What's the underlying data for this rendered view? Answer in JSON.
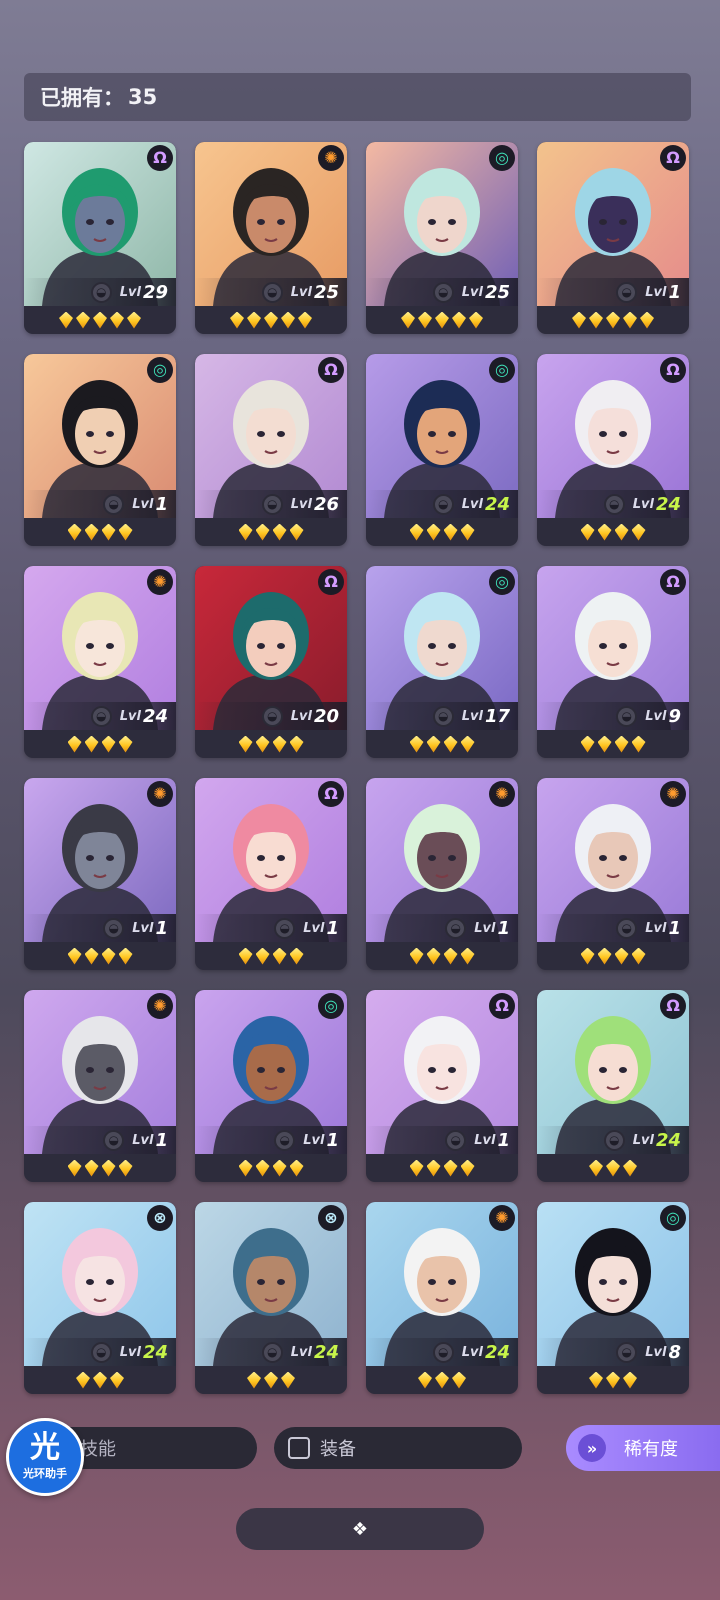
{
  "header": {
    "owned_label": "已拥有：",
    "owned_count": "35"
  },
  "colors": {
    "psychic": "#d39cff",
    "sun": "#ff9b2e",
    "vortex": "#3fe0b8",
    "cross": "#bfefff",
    "star": "#ffc520",
    "level_maxed": "#c8f54a",
    "sort_button": "#9a7cff"
  },
  "level_prefix": "Lvl",
  "heroes": [
    {
      "faction": "psychic",
      "level": "29",
      "stars": 5,
      "bg": [
        "#cfe7e3",
        "#8fb7a8"
      ],
      "hair": "#1f9b6f",
      "skin": "#6c7b9a"
    },
    {
      "faction": "sun",
      "level": "25",
      "stars": 5,
      "bg": [
        "#f7c58f",
        "#e79b64"
      ],
      "hair": "#2a2523",
      "skin": "#c98a6a"
    },
    {
      "faction": "vortex",
      "level": "25",
      "stars": 5,
      "bg": [
        "#f4b9a2",
        "#6f5fb6"
      ],
      "hair": "#bfe7df",
      "skin": "#efd6cc"
    },
    {
      "faction": "psychic",
      "level": "1",
      "stars": 5,
      "bg": [
        "#f3c38c",
        "#e58b8b"
      ],
      "hair": "#9ed6e6",
      "skin": "#3a2f5a"
    },
    {
      "faction": "vortex",
      "level": "1",
      "stars": 4,
      "bg": [
        "#f7c89a",
        "#d98b72"
      ],
      "hair": "#1b1a1f",
      "skin": "#f0cfb3"
    },
    {
      "faction": "psychic",
      "level": "26",
      "stars": 4,
      "bg": [
        "#d6b7e6",
        "#b28ad2"
      ],
      "hair": "#e8e4dc",
      "skin": "#f3ddd2"
    },
    {
      "faction": "vortex",
      "level": "24",
      "stars": 4,
      "bg": [
        "#b69be8",
        "#7c6bc2"
      ],
      "hair": "#1c2c55",
      "skin": "#e3a57a",
      "maxed": true
    },
    {
      "faction": "psychic",
      "level": "24",
      "stars": 4,
      "bg": [
        "#c8a4ee",
        "#9a74d6"
      ],
      "hair": "#f0eef2",
      "skin": "#f5dfda",
      "maxed": true
    },
    {
      "faction": "sun",
      "level": "24",
      "stars": 4,
      "bg": [
        "#d5a8ee",
        "#b17fe0"
      ],
      "hair": "#e8e7b5",
      "skin": "#f7e6da"
    },
    {
      "faction": "psychic",
      "level": "20",
      "stars": 4,
      "bg": [
        "#c8283a",
        "#8a1c2c"
      ],
      "hair": "#1d6b6c",
      "skin": "#f3cdbd"
    },
    {
      "faction": "vortex",
      "level": "17",
      "stars": 4,
      "bg": [
        "#b8a2ec",
        "#7a69c4"
      ],
      "hair": "#bfe6f2",
      "skin": "#efd9cf"
    },
    {
      "faction": "psychic",
      "level": "9",
      "stars": 4,
      "bg": [
        "#c7a4ee",
        "#9a7bd8"
      ],
      "hair": "#eef2f3",
      "skin": "#f6dfd4"
    },
    {
      "faction": "sun",
      "level": "1",
      "stars": 4,
      "bg": [
        "#c9a7ee",
        "#7d6ac0"
      ],
      "hair": "#3a3a46",
      "skin": "#7f8598"
    },
    {
      "faction": "psychic",
      "level": "1",
      "stars": 4,
      "bg": [
        "#d2a7ee",
        "#b07fdf"
      ],
      "hair": "#ef8aa1",
      "skin": "#f8dcd2"
    },
    {
      "faction": "sun",
      "level": "1",
      "stars": 4,
      "bg": [
        "#c7a4ee",
        "#9a7bd8"
      ],
      "hair": "#d9f2da",
      "skin": "#6a4d57"
    },
    {
      "faction": "sun",
      "level": "1",
      "stars": 4,
      "bg": [
        "#c7a4ee",
        "#9a7bd8"
      ],
      "hair": "#eef0f5",
      "skin": "#e8c8b8"
    },
    {
      "faction": "sun",
      "level": "1",
      "stars": 4,
      "bg": [
        "#cfa8ee",
        "#a47fdd"
      ],
      "hair": "#e6e6ea",
      "skin": "#5b5b66"
    },
    {
      "faction": "vortex",
      "level": "1",
      "stars": 4,
      "bg": [
        "#caa4ee",
        "#9c78d9"
      ],
      "hair": "#2a64a6",
      "skin": "#a86b4a"
    },
    {
      "faction": "psychic",
      "level": "1",
      "stars": 4,
      "bg": [
        "#d5acee",
        "#b48ae0"
      ],
      "hair": "#f2f2f5",
      "skin": "#f8e3e0"
    },
    {
      "faction": "psychic",
      "level": "24",
      "stars": 3,
      "bg": [
        "#b9e1e8",
        "#8fc4d4"
      ],
      "hair": "#9fe07a",
      "skin": "#f6ddd3",
      "maxed": true
    },
    {
      "faction": "cross",
      "level": "24",
      "stars": 3,
      "bg": [
        "#bfe3f4",
        "#8fc6ea"
      ],
      "hair": "#f3c8dd",
      "skin": "#f6e3e3",
      "maxed": true
    },
    {
      "faction": "cross",
      "level": "24",
      "stars": 3,
      "bg": [
        "#bcd7e6",
        "#8fb3cf"
      ],
      "hair": "#3e6e8c",
      "skin": "#b5876a",
      "maxed": true
    },
    {
      "faction": "sun",
      "level": "24",
      "stars": 3,
      "bg": [
        "#a9d6ee",
        "#7ab3dd"
      ],
      "hair": "#f3f3f3",
      "skin": "#e9c3aa",
      "maxed": true
    },
    {
      "faction": "vortex",
      "level": "8",
      "stars": 3,
      "bg": [
        "#b9e0f4",
        "#8cc2e8"
      ],
      "hair": "#14141c",
      "skin": "#f4dfd8"
    }
  ],
  "bottom": {
    "skill_filter": "技能",
    "equip_filter": "装备",
    "sort_label": "稀有度",
    "sort_icon": "chevrons-down-icon",
    "expand_icon": "diamonds-expand-icon",
    "assistant_glyph": "光",
    "assistant_label": "光环助手"
  }
}
